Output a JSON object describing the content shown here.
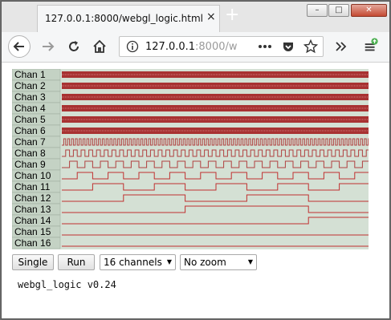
{
  "browser": {
    "tab_title": "127.0.0.1:8000/webgl_logic.html",
    "tab_close": "×",
    "new_tab": "+",
    "url_host": "127.0.0.1",
    "url_rest": ":8000/w",
    "window_min": "–",
    "window_max": "□",
    "window_close": "✕"
  },
  "icons": {
    "back": "back-arrow-icon",
    "forward": "forward-arrow-icon",
    "reload": "reload-icon",
    "home": "home-icon",
    "info": "info-icon",
    "more": "page-actions-icon",
    "pocket": "pocket-icon",
    "bookmark": "bookmark-star-icon",
    "overflow": "overflow-chevrons-icon",
    "menu": "hamburger-menu-icon"
  },
  "logic": {
    "channels": [
      "Chan 1",
      "Chan 2",
      "Chan 3",
      "Chan 4",
      "Chan 5",
      "Chan 6",
      "Chan 7",
      "Chan 8",
      "Chan 9",
      "Chan 10",
      "Chan 11",
      "Chan 12",
      "Chan 13",
      "Chan 14",
      "Chan 15",
      "Chan 16"
    ],
    "colors": {
      "background": "#d4e0d4",
      "label_bg": "#c4d2c4",
      "trace_low": "#555555",
      "trace_high": "#c03030",
      "dense": "#a83232"
    }
  },
  "controls": {
    "single_label": "Single",
    "run_label": "Run",
    "channels_select": "16 channels",
    "zoom_select": "No zoom"
  },
  "version": "webgl_logic v0.24"
}
